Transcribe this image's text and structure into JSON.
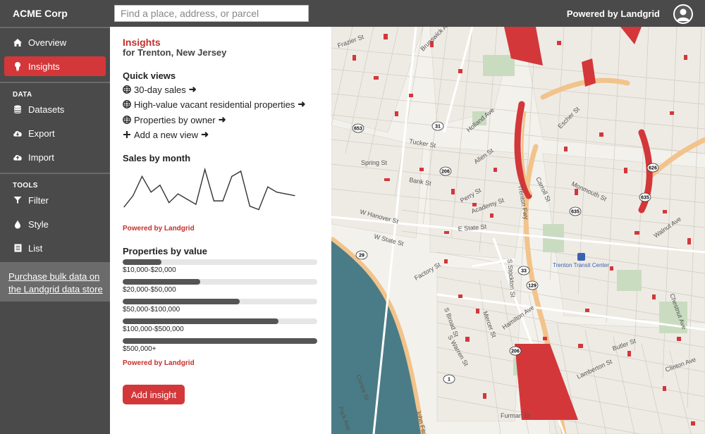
{
  "app": {
    "brand": "ACME Corp",
    "powered_by": "Powered by Landgrid"
  },
  "search": {
    "placeholder": "Find a place, address, or parcel"
  },
  "sidebar": {
    "items": [
      {
        "label": "Overview",
        "icon": "home-icon"
      },
      {
        "label": "Insights",
        "icon": "lightbulb-icon",
        "active": true
      }
    ],
    "data_section": "DATA",
    "data_items": [
      {
        "label": "Datasets",
        "icon": "database-icon"
      },
      {
        "label": "Export",
        "icon": "cloud-download-icon"
      },
      {
        "label": "Import",
        "icon": "cloud-upload-icon"
      }
    ],
    "tools_section": "TOOLS",
    "tools_items": [
      {
        "label": "Filter",
        "icon": "filter-icon"
      },
      {
        "label": "Style",
        "icon": "droplet-icon"
      },
      {
        "label": "List",
        "icon": "list-icon"
      }
    ],
    "promo_link": "Purchase bulk data on the Landgrid data store"
  },
  "panel": {
    "title": "Insights",
    "subtitle": "for Trenton, New Jersey",
    "quick_views_heading": "Quick views",
    "quick_views": [
      "30-day sales",
      "High-value vacant residential properties",
      "Properties by owner"
    ],
    "add_view": "Add a new view",
    "sales_heading": "Sales by month",
    "sales_powered": "Powered by Landgrid",
    "value_heading": "Properties by value",
    "value_powered": "Powered by Landgrid",
    "add_insight": "Add insight"
  },
  "chart_data": [
    {
      "type": "line",
      "title": "Sales by month",
      "x": [
        1,
        2,
        3,
        4,
        5,
        6,
        7,
        8,
        9,
        10,
        11,
        12,
        13,
        14,
        15,
        16,
        17,
        18,
        19,
        20
      ],
      "values": [
        5,
        18,
        40,
        22,
        30,
        10,
        20,
        14,
        8,
        48,
        12,
        12,
        40,
        46,
        6,
        2,
        28,
        22,
        20,
        18
      ],
      "ylim": [
        0,
        50
      ],
      "color": "#333333"
    },
    {
      "type": "bar",
      "title": "Properties by value",
      "categories": [
        "$10,000-$20,000",
        "$20,000-$50,000",
        "$50,000-$100,000",
        "$100,000-$500,000",
        "$500,000+"
      ],
      "values": [
        0.2,
        0.4,
        0.6,
        0.8,
        1.0
      ],
      "color": "#555555"
    }
  ],
  "map": {
    "accent": "#d3373a",
    "water": "#4a7c87",
    "highway": "#f2c38a",
    "street_labels": [
      "Frazier St",
      "Brunswick Ave",
      "Holland Ave",
      "Spring St",
      "Tucker St",
      "Allen St",
      "Perry St",
      "Bank St",
      "W Hanover St",
      "Academy St",
      "W State St",
      "E State St",
      "Factory St",
      "S Broad St",
      "S Warren St",
      "Mercer St",
      "Hamilton Ave",
      "Furman St",
      "Lamberton St",
      "Monmouth St",
      "Walnut Ave",
      "Chestnut Ave",
      "Butler St",
      "Clinton Ave",
      "Carroll St",
      "Escher St",
      "S Stockton St",
      "Trenton Fwy",
      "Centre St",
      "Park Ave",
      "John Fitch Way"
    ],
    "transit_label": "Trenton Transit Center",
    "route_shields": [
      "653",
      "31",
      "206",
      "635",
      "29",
      "33",
      "129",
      "626",
      "635",
      "206",
      "1"
    ]
  }
}
